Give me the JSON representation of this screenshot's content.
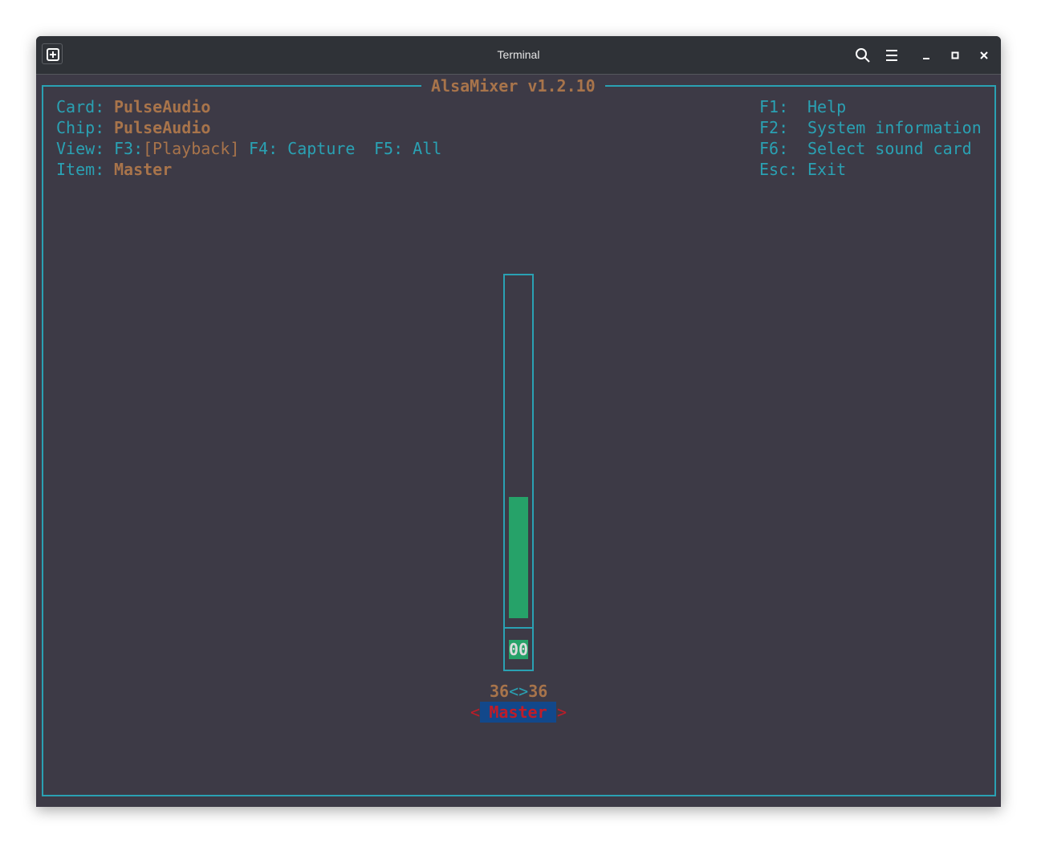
{
  "window": {
    "title": "Terminal"
  },
  "titlebar_icons": [
    "new-tab-icon",
    "search-icon",
    "menu-icon",
    "minimize-icon",
    "maximize-icon",
    "close-icon"
  ],
  "mixer": {
    "title": "AlsaMixer v1.2.10",
    "card_label": "Card:",
    "card_value": "PulseAudio",
    "chip_label": "Chip:",
    "chip_value": "PulseAudio",
    "view_label": "View:",
    "view_f3": "F3:",
    "view_f3_value": "[Playback]",
    "view_f4": "F4: Capture",
    "view_f5": "F5: All",
    "item_label": "Item:",
    "item_value": "Master",
    "keys": [
      {
        "key": "F1:",
        "action": "Help"
      },
      {
        "key": "F2:",
        "action": "System information"
      },
      {
        "key": "F6:",
        "action": "Select sound card"
      },
      {
        "key": "Esc:",
        "action": "Exit"
      }
    ],
    "control": {
      "name": "Master",
      "volume_percent": 36,
      "left_value": "36",
      "separator": "<>",
      "right_value": "36",
      "mute_indicator": "00",
      "left_arrow": "<",
      "right_arrow": ">"
    },
    "colors": {
      "cyan": "#2aa1b3",
      "orange": "#a8744b",
      "green": "#26a269",
      "red": "#c01c28",
      "blue": "#12488b",
      "bg": "#3d3a46"
    }
  }
}
